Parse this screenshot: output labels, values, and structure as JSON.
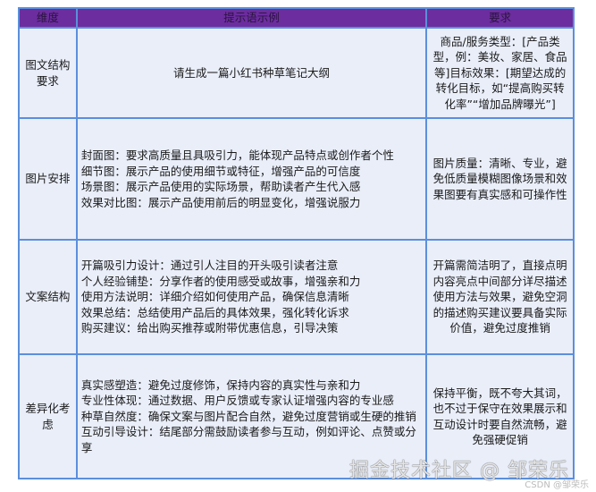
{
  "headers": [
    "维度",
    "提示语示例",
    "要求"
  ],
  "rows": [
    {
      "dimension": "图文结构要求",
      "examples": [
        "请生成一篇小红书种草笔记大纲"
      ],
      "requirement": "商品/服务类型：[产品类型，例：美妆、家居、食品等]目标效果：[期望达成的转化目标，如“提高购买转化率”“增加品牌曝光”]"
    },
    {
      "dimension": "图片安排",
      "examples": [
        "封面图：要求高质量且具吸引力，能体现产品特点或创作者个性",
        "细节图：展示产品的使用细节或特征，增强产品的可信度",
        "场景图：展示产品使用的实际场景，帮助读者产生代入感",
        "效果对比图：展示产品使用前后的明显变化，增强说服力"
      ],
      "requirement": "图片质量：清晰、专业，避免低质量模糊图像场景和效果图要有真实感和可操作性"
    },
    {
      "dimension": "文案结构",
      "examples": [
        "开篇吸引力设计：通过引人注目的开头吸引读者注意",
        "个人经验铺垫：分享作者的使用感受或故事，增强亲和力",
        "使用方法说明：详细介绍如何使用产品，确保信息清晰",
        "效果总结：总结使用产品后的具体效果，强化转化诉求",
        "购买建议：给出购买推荐或附带优惠信息，引导决策"
      ],
      "requirement": "开篇需简洁明了，直接点明内容亮点中间部分详尽描述使用方法与效果，避免空洞的描述购买建议要具备实际价值，避免过度推销"
    },
    {
      "dimension": "差异化考虑",
      "examples": [
        "真实感塑造：避免过度修饰，保持内容的真实性与亲和力",
        "专业性体现：通过数据、用户反馈或专家认证增强内容的专业感",
        "种草自然度：确保文案与图片配合自然，避免过度营销或生硬的推销",
        "互动引导设计：结尾部分需鼓励读者参与互动，例如评论、点赞或分享"
      ],
      "requirement": "保持平衡，既不夸大其词，也不过于保守在效果展示和互动设计时要自然流畅，避免强硬促销"
    }
  ],
  "watermark": "掘金技术社区 @ 邹荣乐",
  "watermark_small": "CSDN @邹荣乐"
}
